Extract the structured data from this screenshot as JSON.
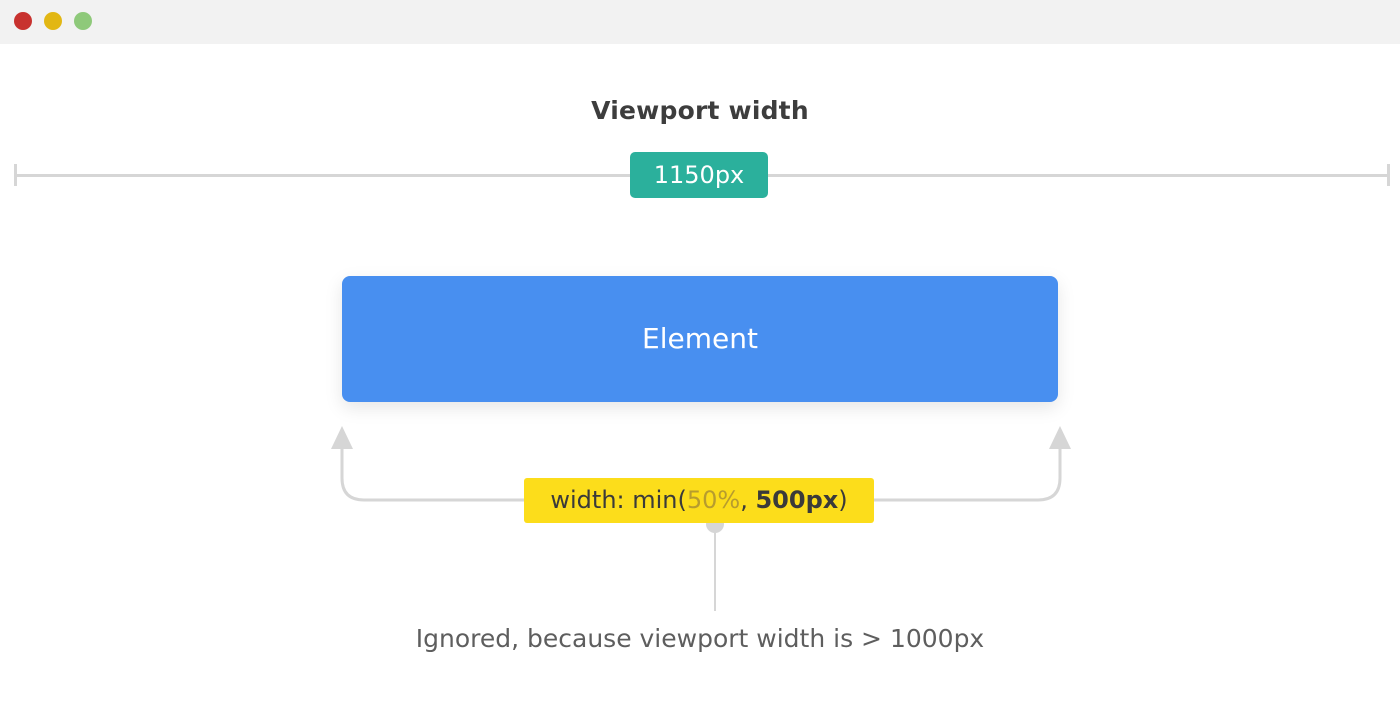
{
  "window": {
    "controls": [
      {
        "name": "close",
        "color": "#c8322f"
      },
      {
        "name": "minimize",
        "color": "#e2b714"
      },
      {
        "name": "maximize",
        "color": "#8ec97a"
      }
    ],
    "background": "#f2f2f2"
  },
  "diagram": {
    "heading": "Viewport width",
    "viewport_value": "1150px",
    "viewport_badge_color": "#2bb09c",
    "element_label": "Element",
    "element_color": "#488ff0",
    "connector_color": "#d6d6d6",
    "code": {
      "prefix": "width: min(",
      "option_a": "50%",
      "separator": ", ",
      "option_b": "500px",
      "suffix": ")",
      "badge_color": "#fcdd1b"
    },
    "note": "Ignored, because viewport width is > 1000px"
  }
}
